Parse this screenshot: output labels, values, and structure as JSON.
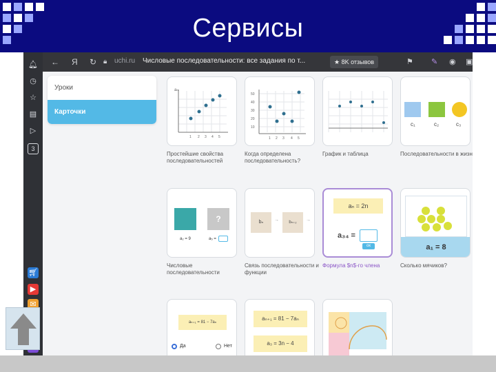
{
  "slide_title": "Сервисы",
  "browser": {
    "nav_back": "←",
    "nav_logo": "Я",
    "nav_reload": "↻",
    "url": "uchi.ru",
    "page_title": "Числовые последовательности: все задания по т...",
    "reviews_badge": "★ 8K отзывов"
  },
  "sidebar": {
    "items": [
      {
        "label": "Уроки"
      },
      {
        "label": "Карточки"
      }
    ]
  },
  "cards": [
    {
      "caption": "Простейшие свойства последовательностей"
    },
    {
      "caption": "Когда определена последовательность?"
    },
    {
      "caption": "График и таблица"
    },
    {
      "caption": "Последовательности в жизни"
    },
    {
      "caption": "Числовые последовательности"
    },
    {
      "caption": "Связь последовательности и функции"
    },
    {
      "caption": "Формула $n$-го члена"
    },
    {
      "caption": "Сколько мячиков?"
    }
  ],
  "card_texts": {
    "c1_axis_y": "aₙ",
    "c1_ticks": [
      "1",
      "2",
      "3",
      "4",
      "5"
    ],
    "c2_yticks": [
      "50",
      "40",
      "30",
      "20",
      "10"
    ],
    "c2_ticks": [
      "1",
      "2",
      "3",
      "4",
      "5"
    ],
    "c4_labels": [
      "c₁",
      "c₂",
      "c₃"
    ],
    "c5_eq1": "a₂ = 9",
    "c5_eq2": "a₅ =",
    "c5_q": "?",
    "c6_b1": "bₙ",
    "c6_b2": "bₙ₊₂",
    "c7_formula": "aₙ = 2n",
    "c7_a34": "a₃₄ =",
    "c7_ok": "ок",
    "c8_eq": "a₁ = 8",
    "c9_eq": "aₙ₊₁ = 81 − 7aₙ",
    "c9_yes": "Да",
    "c9_no": "Нет",
    "c10_eq1": "aₙ₊₁ = 81 − 7aₙ",
    "c10_eq2": "a₃ = 3n − 4"
  },
  "colors": {
    "title_bg": "#0b0b80",
    "accent": "#53b9e6",
    "selected_border": "#a98bd6",
    "dot": "#2f6f8f"
  }
}
